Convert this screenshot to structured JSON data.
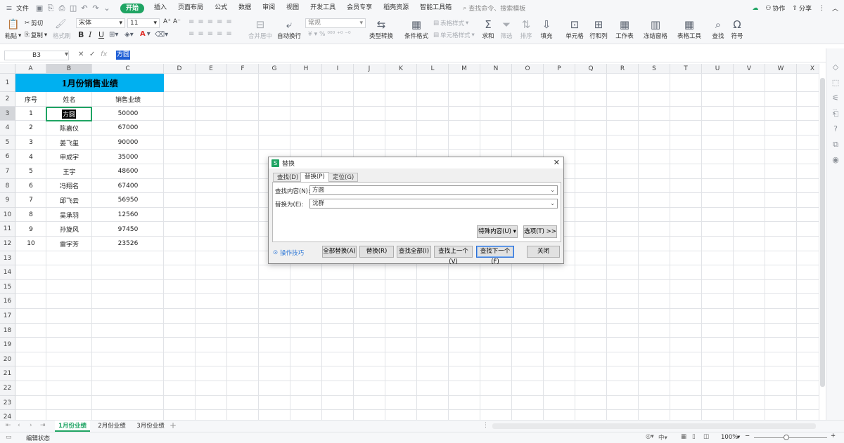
{
  "menubar": {
    "file": "文件",
    "tabs": [
      "开始",
      "插入",
      "页面布局",
      "公式",
      "数据",
      "审阅",
      "视图",
      "开发工具",
      "会员专享",
      "稻壳资源",
      "智能工具箱"
    ],
    "active_tab": "开始",
    "search_placeholder": "查找命令、搜索模板",
    "collab": "协作",
    "share": "分享"
  },
  "ribbon": {
    "paste": "粘贴",
    "cut": "剪切",
    "copy": "复制",
    "format_painter": "格式刷",
    "font_name": "宋体",
    "font_size": "11",
    "bold": "B",
    "italic": "I",
    "underline": "U",
    "merge_center": "合并居中",
    "wrap_text": "自动换行",
    "number_format": "常规",
    "type_convert": "类型转换",
    "conditional_format": "条件格式",
    "table_style": "表格样式",
    "cell_style": "单元格样式",
    "sum": "求和",
    "filter": "筛选",
    "sort": "排序",
    "fill": "填充",
    "cell": "单元格",
    "row_col": "行和列",
    "worksheet": "工作表",
    "freeze": "冻结窗格",
    "table_tools": "表格工具",
    "find": "查找",
    "symbol": "符号"
  },
  "formula_bar": {
    "name_box": "B3",
    "content": "方圆"
  },
  "sheet": {
    "columns": [
      "A",
      "B",
      "C",
      "D",
      "E",
      "F",
      "G",
      "H",
      "I",
      "J",
      "K",
      "L",
      "M",
      "N",
      "O",
      "P",
      "Q",
      "R",
      "S",
      "T",
      "U",
      "V",
      "W",
      "X"
    ],
    "row_numbers": [
      "1",
      "2",
      "3",
      "4",
      "5",
      "6",
      "7",
      "8",
      "9",
      "10",
      "11",
      "12",
      "13",
      "14",
      "15",
      "16",
      "17",
      "18",
      "19",
      "20",
      "21",
      "22",
      "23",
      "24"
    ],
    "title": "1月份销售业绩",
    "headers": [
      "序号",
      "姓名",
      "销售业绩"
    ],
    "rows": [
      [
        "1",
        "方圆",
        "50000"
      ],
      [
        "2",
        "陈嘉仪",
        "67000"
      ],
      [
        "3",
        "姜飞玺",
        "90000"
      ],
      [
        "4",
        "申成宇",
        "35000"
      ],
      [
        "5",
        "王宇",
        "48600"
      ],
      [
        "6",
        "冯翔名",
        "67400"
      ],
      [
        "7",
        "邱飞云",
        "56950"
      ],
      [
        "8",
        "吴承羽",
        "12560"
      ],
      [
        "9",
        "孙旋风",
        "97450"
      ],
      [
        "10",
        "雷宇芳",
        "23526"
      ]
    ]
  },
  "sheet_tabs": [
    "1月份业绩",
    "2月份业绩",
    "3月份业绩"
  ],
  "status": {
    "mode": "编辑状态",
    "zoom": "100%"
  },
  "dialog": {
    "title": "替换",
    "tabs": [
      "查找(D)",
      "替换(P)",
      "定位(G)"
    ],
    "active_tab": "替换(P)",
    "find_label": "查找内容(N):",
    "find_value": "方圆",
    "replace_label": "替换为(E):",
    "replace_value": "沈群",
    "special_btn": "特殊内容(U)",
    "options_btn": "选项(T) >>",
    "tips": "操作技巧",
    "replace_all": "全部替换(A)",
    "replace": "替换(R)",
    "find_all": "查找全部(I)",
    "find_prev": "查找上一个(V)",
    "find_next": "查找下一个(F)",
    "close": "关闭"
  },
  "colors": {
    "accent": "#1fa463",
    "title_fill": "#00b0f0",
    "selection": "#1f5fd6"
  }
}
